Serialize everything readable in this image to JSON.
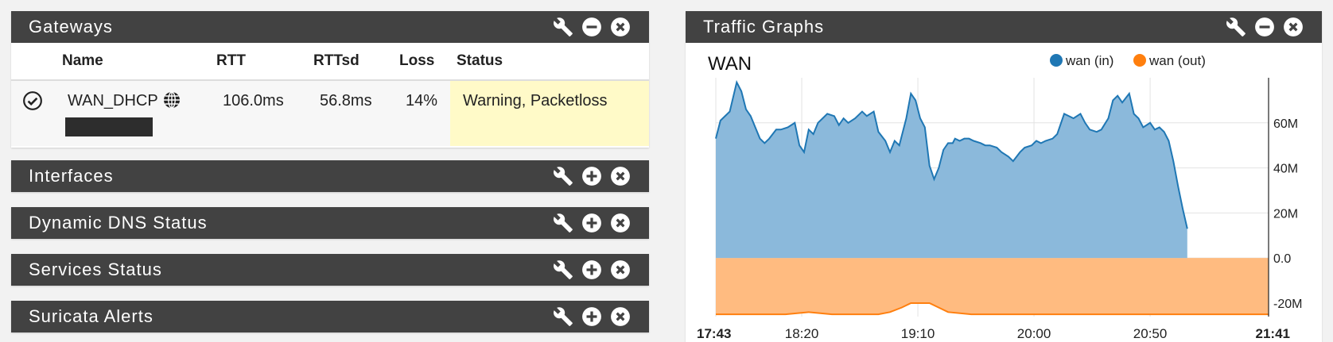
{
  "colors": {
    "header_bg": "#424242",
    "warning_bg": "#fffac8",
    "wan_in": "#1f77b4",
    "wan_out": "#ff7f0e"
  },
  "gateways": {
    "title": "Gateways",
    "columns": {
      "name": "Name",
      "rtt": "RTT",
      "rttsd": "RTTsd",
      "loss": "Loss",
      "status": "Status"
    },
    "rows": [
      {
        "status_icon": "check-circle-icon",
        "name": "WAN_DHCP",
        "type_icon": "globe-icon",
        "rtt": "106.0ms",
        "rttsd": "56.8ms",
        "loss": "14%",
        "status": "Warning, Packetloss"
      }
    ]
  },
  "interfaces": {
    "title": "Interfaces"
  },
  "ddns": {
    "title": "Dynamic DNS Status"
  },
  "services": {
    "title": "Services Status"
  },
  "suricata": {
    "title": "Suricata Alerts"
  },
  "traffic": {
    "title": "Traffic Graphs",
    "chart_data": {
      "type": "area",
      "title": "WAN",
      "legend_placement": "top-right",
      "y_ticks": [
        "-20M",
        "0.0",
        "20M",
        "40M",
        "60M"
      ],
      "ylim": [
        -26,
        80
      ],
      "x_ticks": [
        "17:43",
        "18:20",
        "19:10",
        "20:00",
        "20:50",
        "21:41"
      ],
      "x_tick_minutes": [
        0,
        37,
        87,
        137,
        187,
        238
      ],
      "grid": true,
      "series": [
        {
          "name": "wan (in)",
          "minutes": [
            0,
            2,
            4,
            6,
            9,
            11,
            13,
            15,
            17,
            19,
            21,
            23,
            26,
            28,
            31,
            34,
            36,
            38,
            40,
            42,
            44,
            46,
            48,
            51,
            53,
            55,
            57,
            60,
            63,
            65,
            68,
            70,
            73,
            75,
            77,
            79,
            82,
            84,
            86,
            88,
            90,
            92,
            94,
            96,
            98,
            100,
            102,
            103,
            105,
            107,
            109,
            111,
            114,
            116,
            118,
            121,
            123,
            126,
            128,
            131,
            133,
            136,
            138,
            140,
            142,
            145,
            147,
            150,
            152,
            154,
            157,
            159,
            161,
            164,
            166,
            169,
            171,
            173,
            175,
            178,
            180,
            182,
            184,
            187,
            189,
            191,
            193,
            195,
            197,
            199,
            201,
            203,
            206,
            208,
            210,
            212,
            215,
            217,
            219,
            221,
            223,
            225,
            227,
            229,
            231,
            233,
            236,
            238
          ],
          "values": [
            53,
            61,
            63,
            65,
            78,
            74,
            66,
            63,
            58,
            53,
            51,
            53,
            57,
            57,
            58,
            60,
            50,
            47,
            57,
            55,
            60,
            62,
            64,
            63,
            59,
            62,
            60,
            62,
            65,
            63,
            65,
            56,
            52,
            47,
            52,
            50,
            62,
            73,
            70,
            62,
            58,
            41,
            35,
            40,
            48,
            51,
            51,
            53,
            52,
            53,
            53,
            52,
            51,
            50,
            50,
            49,
            47,
            45,
            43,
            47,
            49,
            50,
            52,
            51,
            52,
            53,
            55,
            64,
            63,
            62,
            64,
            60,
            57,
            56,
            57,
            62,
            70,
            72,
            69,
            73,
            64,
            62,
            58,
            60,
            57,
            58,
            56,
            52,
            43,
            32,
            22,
            13,
            10,
            0,
            0,
            0,
            0,
            0,
            0,
            0,
            0,
            0,
            0,
            0,
            0,
            0,
            0,
            0
          ],
          "values_note_clip": 91
        },
        {
          "name": "wan (out)",
          "minutes": [
            0,
            10,
            20,
            30,
            40,
            50,
            60,
            70,
            75,
            80,
            84,
            88,
            92,
            96,
            100,
            110,
            120,
            130,
            140,
            150,
            160,
            170,
            180,
            190,
            200,
            210,
            220,
            230,
            238
          ],
          "values": [
            -25,
            -25,
            -25,
            -25,
            -24,
            -25,
            -25,
            -25,
            -24,
            -22,
            -20,
            -20,
            -20,
            -22,
            -24,
            -25,
            -25,
            -25,
            -25,
            -25,
            -25,
            -25,
            -25,
            -25,
            -25,
            -25,
            -25,
            -25,
            -25
          ]
        }
      ]
    }
  }
}
